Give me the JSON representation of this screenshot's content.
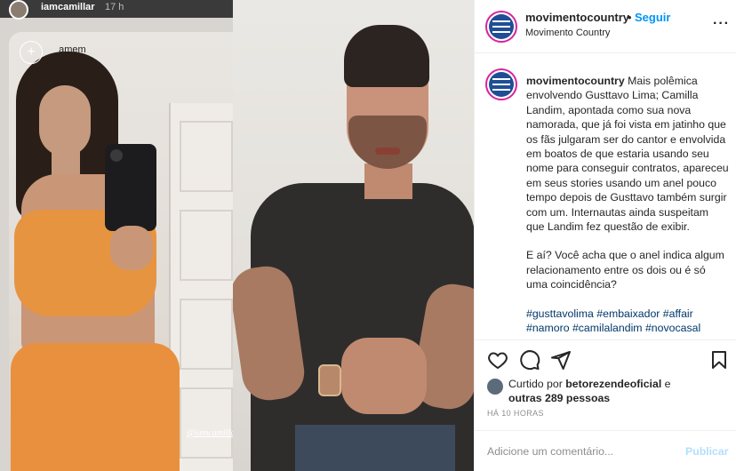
{
  "story": {
    "username": "iamcamillar",
    "time": "17 h",
    "music_user": "_amem",
    "tag": "@iamcamillar"
  },
  "post": {
    "account": "movimentocountry",
    "dot": "•",
    "follow_label": "Seguir",
    "subtitle": "Movimento Country",
    "more_icon": "more-horizontal-icon",
    "caption_user": "movimentocountry",
    "caption_p1": "Mais polêmica envolvendo Gusttavo Lima; Camilla Landim, apontada como sua nova namorada, que já foi vista em jatinho que os fãs julgaram ser do cantor e envolvida em boatos de que estaria usando seu nome para conseguir contratos, apareceu em seus stories usando um anel pouco tempo depois de Gusttavo também surgir com um. Internautas ainda suspeitam que Landim fez questão de exibir.",
    "caption_p2": "E aí? Você acha que o anel indica algum relacionamento entre os dois ou é só uma coincidência?",
    "hashtags": "#gusttavolima #embaixador #affair #namoro #camilalandim #novocasal",
    "liked_prefix": "Curtido por",
    "liked_user": "betorezendeoficial",
    "liked_conj": "e",
    "liked_others": "outras 289 pessoas",
    "time_ago": "HÁ 10 HORAS",
    "comment_placeholder": "Adicione um comentário...",
    "publish_label": "Publicar"
  },
  "colors": {
    "follow": "#0095f6",
    "publish_disabled": "#b2dffc",
    "hashtag": "#00376b"
  }
}
